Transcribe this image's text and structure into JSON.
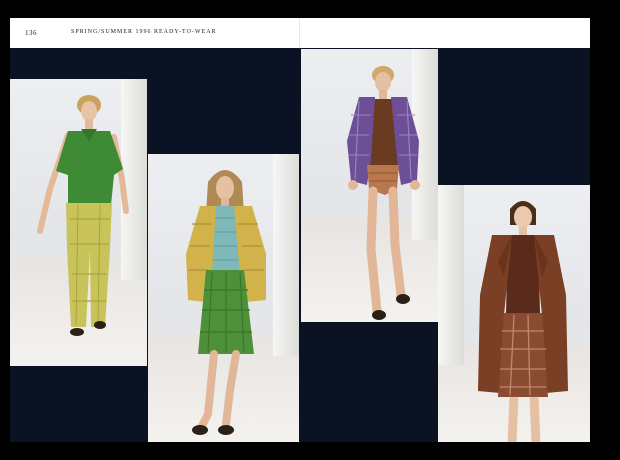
{
  "header": {
    "page_number": "136",
    "running_head": "SPRING/SUMMER 1996 READY-TO-WEAR"
  },
  "colors": {
    "page_background": "#0b1224",
    "header_background": "#ffffff",
    "look1_top": "#3f8a35",
    "look1_trousers": "#c9c45a",
    "look2_jacket": "#d2b24a",
    "look2_skirt": "#4e8f3a",
    "look3_jacket": "#6c4f96",
    "look3_top": "#6a3b20",
    "look4_coat": "#7a3f25",
    "look4_skirt": "#8a4b33"
  },
  "photos": [
    {
      "id": "look-1",
      "description_icon": "runway-look-icon"
    },
    {
      "id": "look-2",
      "description_icon": "runway-look-icon"
    },
    {
      "id": "look-3",
      "description_icon": "runway-look-icon"
    },
    {
      "id": "look-4",
      "description_icon": "runway-look-icon"
    }
  ]
}
